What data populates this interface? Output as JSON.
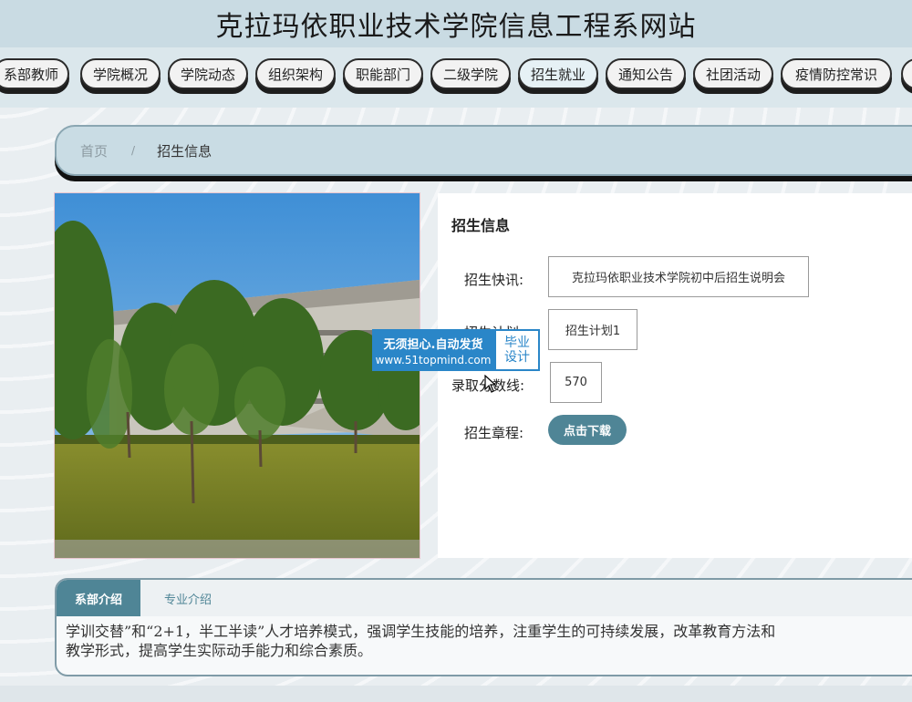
{
  "site": {
    "title": "克拉玛依职业技术学院信息工程系网站"
  },
  "nav": {
    "items": [
      {
        "label": "系部教师"
      },
      {
        "label": "学院概况"
      },
      {
        "label": "学院动态"
      },
      {
        "label": "组织架构"
      },
      {
        "label": "职能部门"
      },
      {
        "label": "二级学院"
      },
      {
        "label": "招生就业"
      },
      {
        "label": "通知公告"
      },
      {
        "label": "社团活动"
      },
      {
        "label": "疫情防控常识"
      }
    ]
  },
  "breadcrumb": {
    "home": "首页",
    "separator": "/",
    "current": "招生信息"
  },
  "info": {
    "title": "招生信息",
    "fields": [
      {
        "label": "招生快讯:",
        "value": "克拉玛依职业技术学院初中后招生说明会"
      },
      {
        "label": "招生计划:",
        "value": "招生计划1"
      },
      {
        "label": "录取分数线:",
        "value": "570"
      },
      {
        "label": "招生章程:",
        "button": "点击下载"
      }
    ]
  },
  "watermark": {
    "line1": "无须担心.自动发货",
    "line2": "www.51topmind.com",
    "badge_top": "毕业",
    "badge_bottom": "设计"
  },
  "tabs": {
    "items": [
      {
        "label": "系部介绍"
      },
      {
        "label": "专业介绍"
      }
    ],
    "content_line1": "学训交替”和“2+1，半工半读”人才培养模式，强调学生技能的培养，注重学生的可持续发展，改革教育方法和",
    "content_line2": "教学形式，提高学生实际动手能力和综合素质。"
  },
  "colors": {
    "accent": "#4f8596",
    "header_bg": "#c9dbe3",
    "watermark": "#2a86c8"
  }
}
